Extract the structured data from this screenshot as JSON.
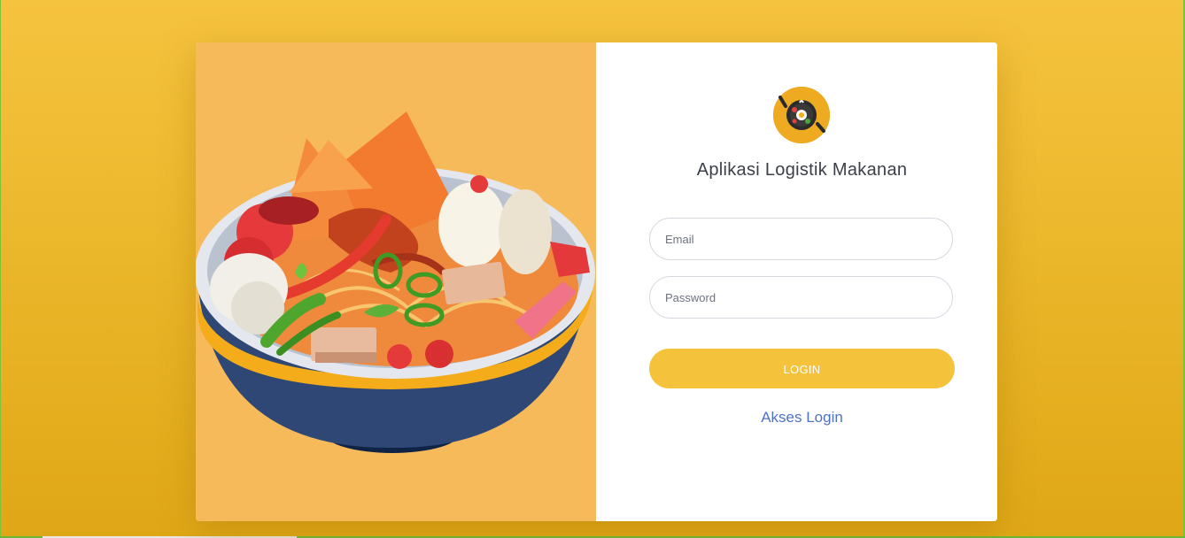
{
  "app": {
    "title": "Aplikasi Logistik Makanan",
    "logo_icon": "food-bowl-logo-icon"
  },
  "form": {
    "email_placeholder": "Email",
    "password_placeholder": "Password",
    "login_label": "LOGIN",
    "akses_link": "Akses Login"
  },
  "illustration": {
    "icon": "noodle-soup-bowl-illustration"
  },
  "colors": {
    "background": "#f0bb32",
    "panel": "#f7ba5b",
    "button": "#f4c23b",
    "link": "#4e73c4",
    "title": "#3b3f48"
  }
}
